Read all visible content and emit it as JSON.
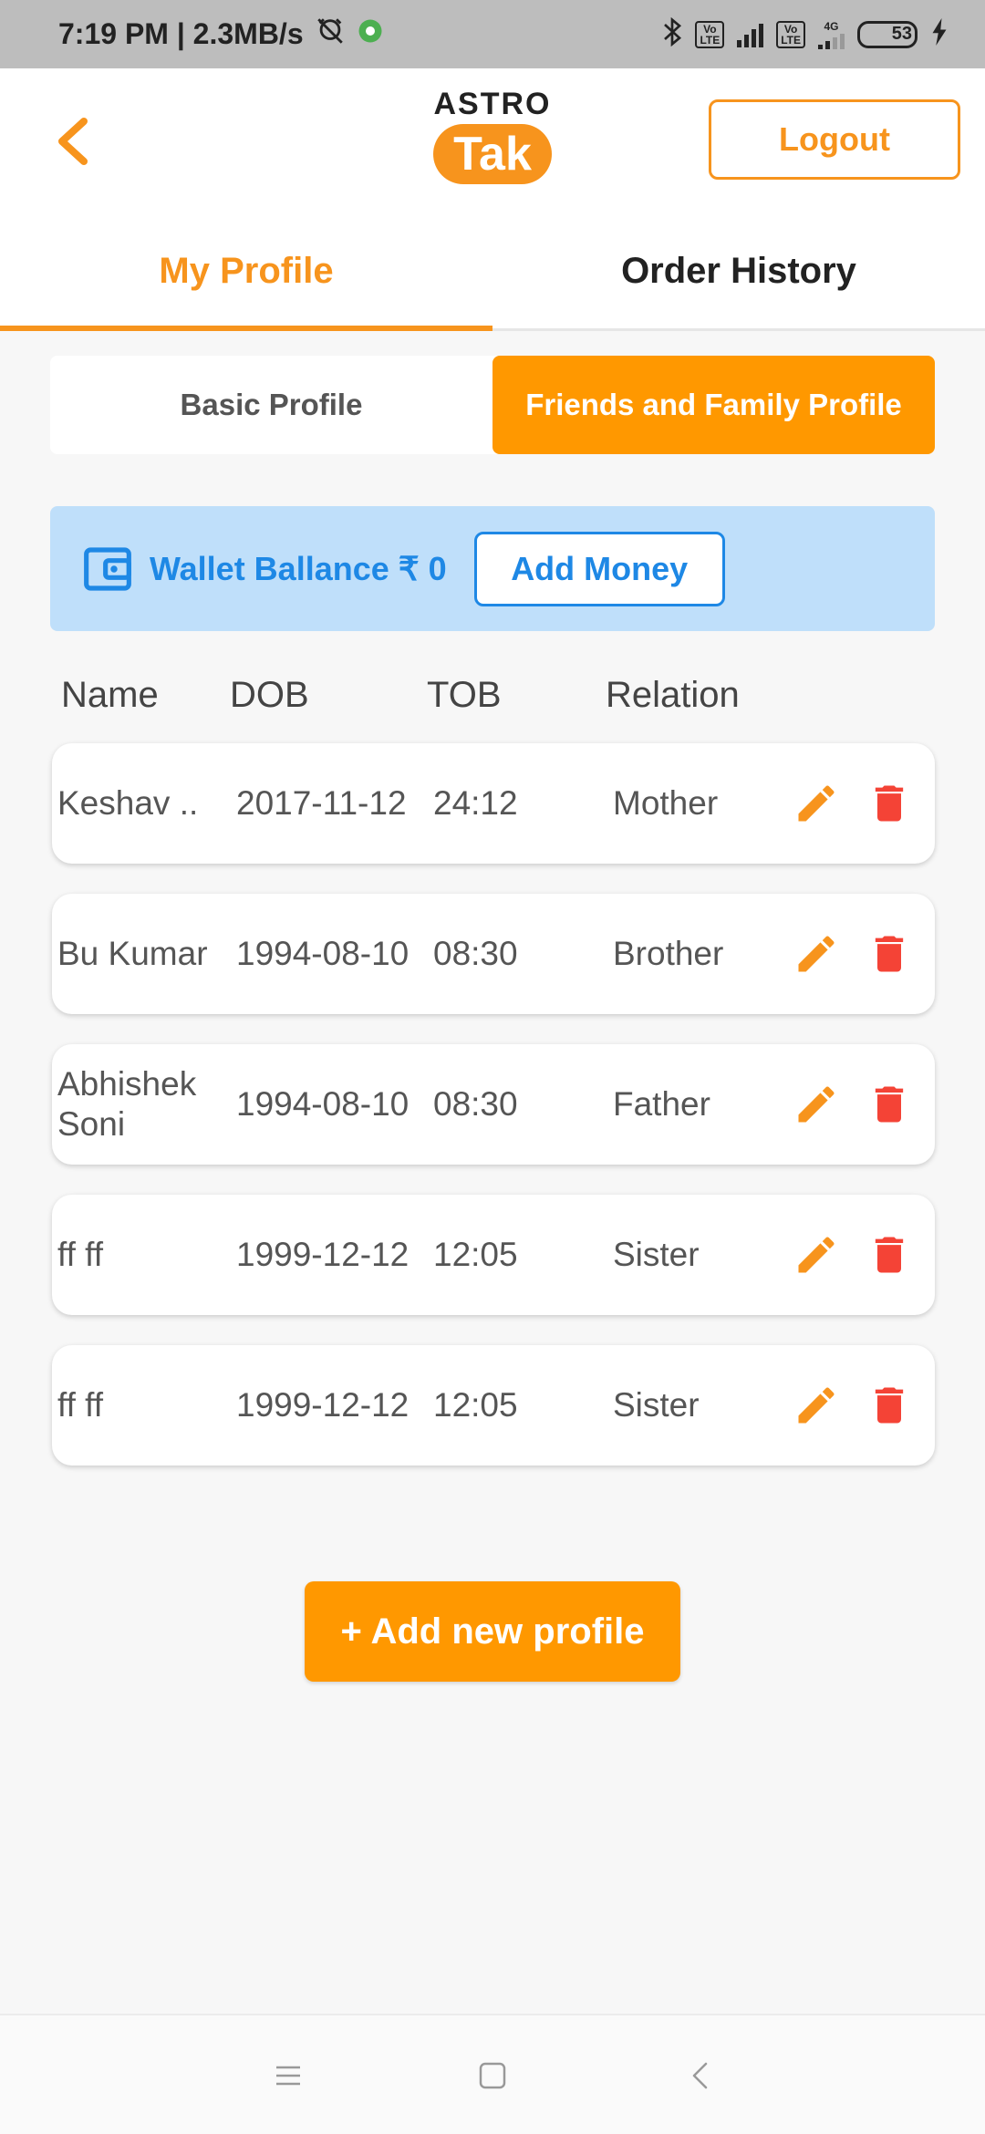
{
  "status_bar": {
    "time_speed": "7:19 PM | 2.3MB/s",
    "battery_level": "53",
    "network_4g": "4G"
  },
  "header": {
    "logo_top": "ASTRO",
    "logo_bottom": "Tak",
    "logout_label": "Logout",
    "accent_color": "#f7941d"
  },
  "main_tabs": [
    {
      "label": "My Profile",
      "active": true
    },
    {
      "label": "Order History",
      "active": false
    }
  ],
  "sub_tabs": [
    {
      "label": "Basic Profile",
      "active": false
    },
    {
      "label": "Friends and Family Profile",
      "active": true
    }
  ],
  "wallet": {
    "label": "Wallet Ballance ₹ 0",
    "add_money_label": "Add Money"
  },
  "table": {
    "headers": {
      "name": "Name",
      "dob": "DOB",
      "tob": "TOB",
      "relation": "Relation"
    },
    "rows": [
      {
        "name": "Keshav ..",
        "dob": "2017-11-12",
        "tob": "24:12",
        "relation": "Mother"
      },
      {
        "name": "Bu Kumar",
        "dob": "1994-08-10",
        "tob": "08:30",
        "relation": "Brother"
      },
      {
        "name": "Abhishek Soni",
        "dob": "1994-08-10",
        "tob": "08:30",
        "relation": "Father"
      },
      {
        "name": "ff ff",
        "dob": "1999-12-12",
        "tob": "12:05",
        "relation": "Sister"
      },
      {
        "name": "ff ff",
        "dob": "1999-12-12",
        "tob": "12:05",
        "relation": "Sister"
      }
    ]
  },
  "add_profile_label": "+ Add new profile",
  "nav_icons": [
    "menu-icon",
    "home-square-icon",
    "back-triangle-icon"
  ]
}
